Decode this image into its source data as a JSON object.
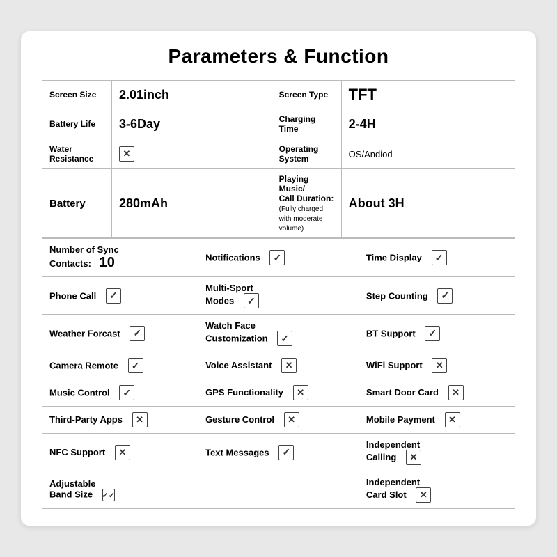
{
  "title": "Parameters & Function",
  "specs": [
    {
      "rows": [
        [
          {
            "label": "Screen Size",
            "value": "2.01inch",
            "valueClass": "value"
          },
          {
            "label": "Screen Type",
            "value": "TFT",
            "valueClass": "value"
          }
        ],
        [
          {
            "label": "Battery Life",
            "value": "3-6Day",
            "valueClass": "value"
          },
          {
            "label": "Charging Time",
            "value": "2-4H",
            "valueClass": "value"
          }
        ],
        [
          {
            "label": "Water Resistance",
            "value": "✕",
            "valueClass": "checkbox-cell"
          },
          {
            "label": "Operating System",
            "value": "OS/Andiod",
            "valueClass": "value-sm"
          }
        ],
        [
          {
            "label": "Battery",
            "value": "280mAh",
            "valueClass": "value"
          },
          {
            "label": "Playing Music/ Call Duration:",
            "sub": "(Fully charged with moderate volume)",
            "value": "About 3H",
            "valueClass": "value"
          }
        ]
      ]
    }
  ],
  "features": {
    "header_row": [
      {
        "label": "Number of Sync Contacts:",
        "num": "10",
        "colspan": 1
      },
      {
        "label": "Notifications",
        "checked": true
      },
      {
        "label": "Time Display",
        "checked": true
      }
    ],
    "rows": [
      [
        {
          "label": "Phone Call",
          "checked": true
        },
        {
          "label": "Multi-Sport Modes",
          "checked": true
        },
        {
          "label": "Step Counting",
          "checked": true
        }
      ],
      [
        {
          "label": "Weather Forcast",
          "checked": true
        },
        {
          "label": "Watch Face Customization",
          "checked": true
        },
        {
          "label": "BT Support",
          "checked": true
        }
      ],
      [
        {
          "label": "Camera Remote",
          "checked": true
        },
        {
          "label": "Voice Assistant",
          "checked": false
        },
        {
          "label": "WiFi Support",
          "checked": false
        }
      ],
      [
        {
          "label": "Music Control",
          "checked": true
        },
        {
          "label": "GPS Functionality",
          "checked": false
        },
        {
          "label": "Smart Door Card",
          "checked": false
        }
      ],
      [
        {
          "label": "Third-Party Apps",
          "checked": false
        },
        {
          "label": "Gesture Control",
          "checked": false
        },
        {
          "label": "Mobile Payment",
          "checked": false
        }
      ],
      [
        {
          "label": "NFC Support",
          "checked": false
        },
        {
          "label": "Text Messages",
          "checked": true
        },
        {
          "label": "Independent Calling",
          "checked": false
        }
      ],
      [
        {
          "label": "Adjustable Band Size",
          "checked": true,
          "checkedSmall": true
        },
        {
          "label": "",
          "empty": true
        },
        {
          "label": "Independent Card Slot",
          "checked": false
        }
      ]
    ]
  }
}
